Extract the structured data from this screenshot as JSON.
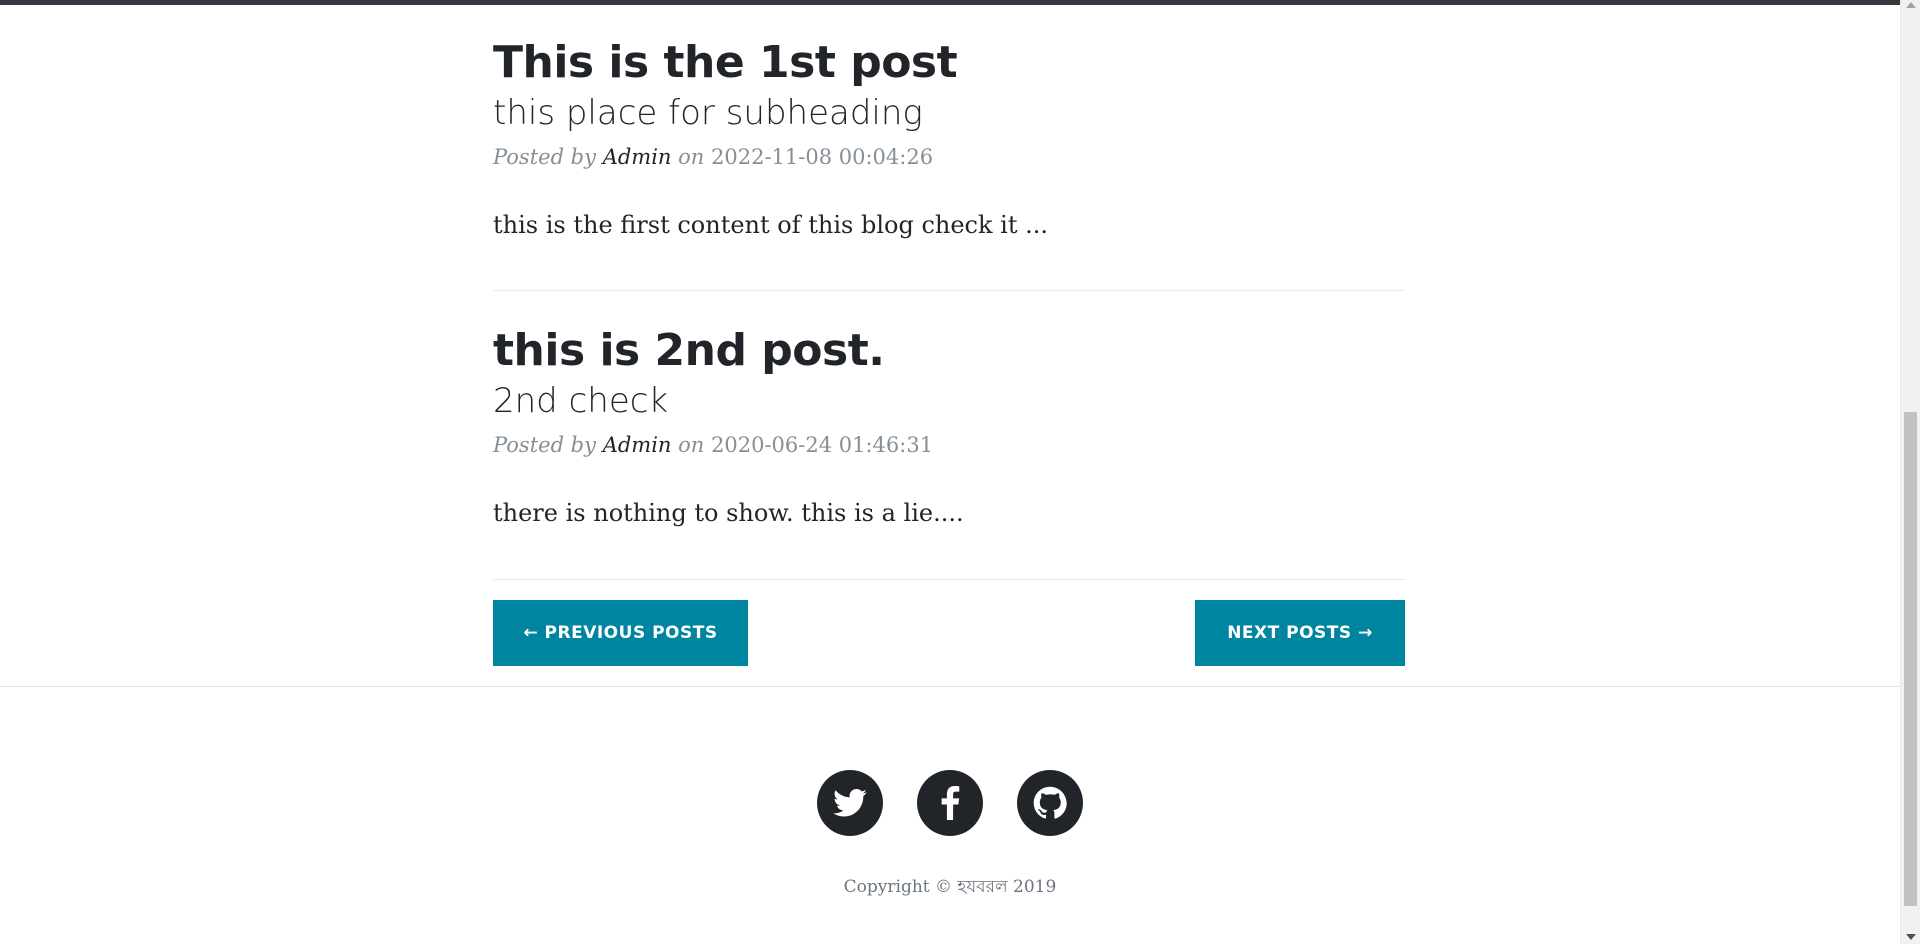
{
  "posts": [
    {
      "title": "This is the 1st post",
      "subtitle": "this place for subheading",
      "posted_by_label": "Posted by",
      "author": "Admin",
      "on_label": "on",
      "date": "2022-11-08 00:04:26",
      "excerpt": "this is the first content of this blog check it ..."
    },
    {
      "title": "this is 2nd post.",
      "subtitle": "2nd check",
      "posted_by_label": "Posted by",
      "author": "Admin",
      "on_label": "on",
      "date": "2020-06-24 01:46:31",
      "excerpt": "there is nothing to show. this is a lie...."
    }
  ],
  "pager": {
    "prev_label": "← PREVIOUS POSTS",
    "next_label": "NEXT POSTS →"
  },
  "footer": {
    "social": [
      "twitter-icon",
      "facebook-icon",
      "github-icon"
    ],
    "copyright": "Copyright © হযবরল 2019"
  },
  "colors": {
    "accent": "#0085a1",
    "text": "#212529",
    "muted": "#868e96",
    "social_bg": "#212529"
  }
}
